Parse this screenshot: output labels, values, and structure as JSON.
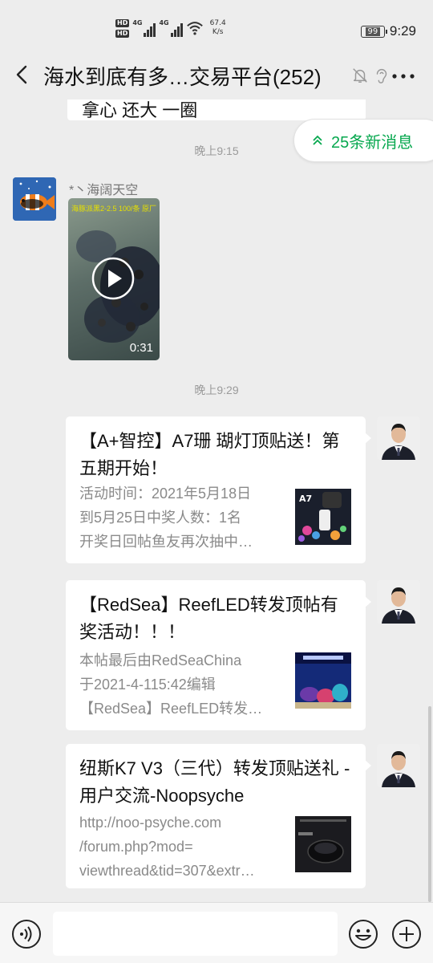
{
  "status_bar": {
    "hd_badge_1": "HD",
    "hd_badge_2": "HD",
    "net_1": "4G",
    "net_2": "4G",
    "speed_value": "67.4",
    "speed_unit": "K/s",
    "battery": "99",
    "time": "9:29"
  },
  "header": {
    "title": "海水到底有多…交易平台(252)"
  },
  "chat": {
    "partial_text": "拿心 还大 一圈",
    "new_messages_label": "25条新消息",
    "messages": [
      {
        "type": "timestamp",
        "text": "晚上9:15"
      },
      {
        "type": "video",
        "sender": "*丶海阔天空",
        "caption": "海豚派黑2-2.5 100/条 原厂",
        "duration": "0:31"
      },
      {
        "type": "timestamp",
        "text": "晚上9:29"
      }
    ],
    "cards": [
      {
        "title": "【A+智控】A7珊 瑚灯顶贴送！第五期开始！",
        "desc": [
          "活动时间：2021年5月18日",
          "到5月25日中奖人数：1名",
          "开奖日回帖鱼友再次抽中…"
        ],
        "thumb_label": "A7"
      },
      {
        "title": "【RedSea】ReefLED转发顶帖有奖活动！！！",
        "desc": [
          "本帖最后由RedSeaChina",
          "于2021-4-115:42编辑",
          "【RedSea】ReefLED转发…"
        ],
        "thumb_label": ""
      },
      {
        "title": "纽斯K7 V3（三代）转发顶贴送礼 - 用户交流-Noopsyche",
        "desc": [
          "http://noo-psyche.com",
          "/forum.php?mod=",
          "viewthread&tid=307&extr…"
        ],
        "thumb_label": ""
      }
    ]
  },
  "input_bar": {
    "value": "",
    "placeholder": ""
  },
  "colors": {
    "background": "#ededed",
    "accent_green": "#07a84f",
    "bubble": "#ffffff",
    "muted_text": "#8a8a8a"
  }
}
